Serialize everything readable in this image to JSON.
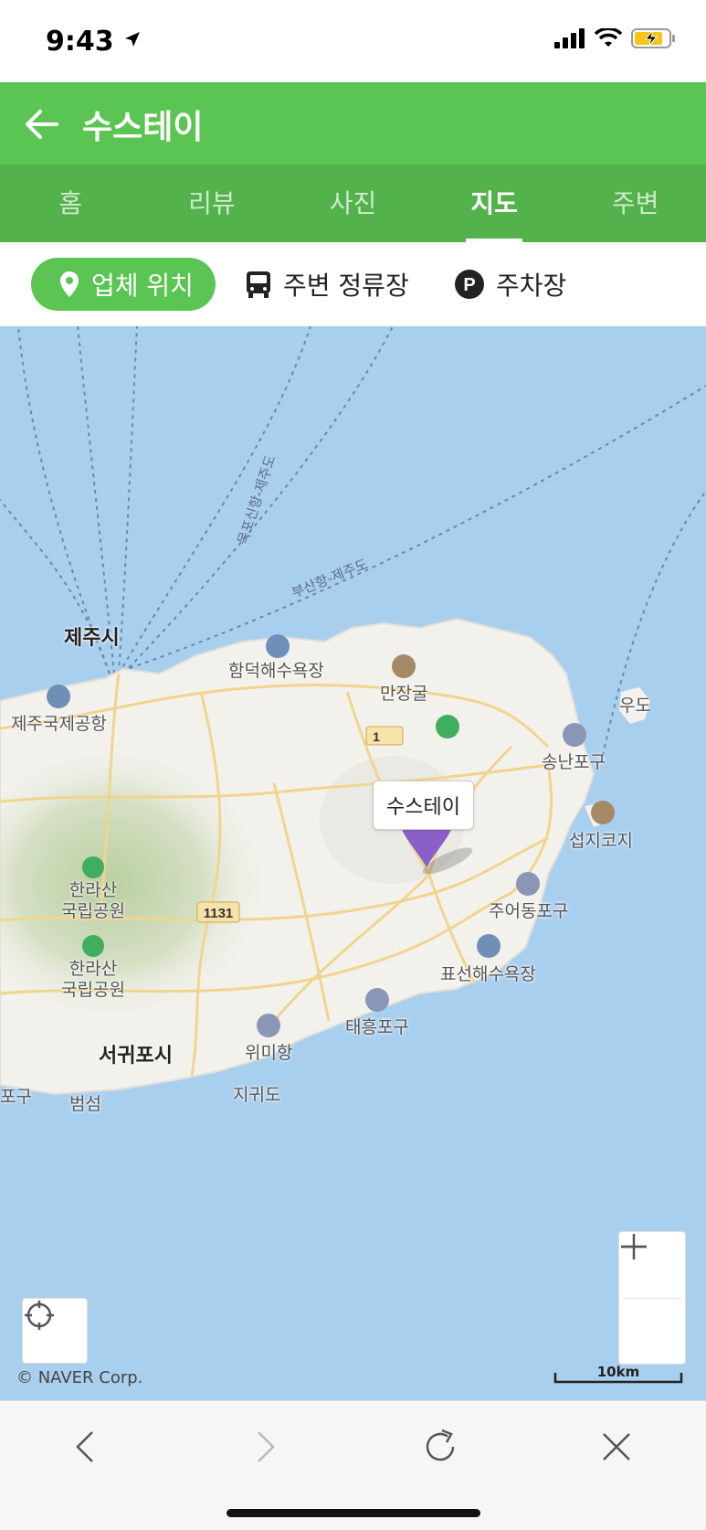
{
  "status": {
    "time": "9:43"
  },
  "header": {
    "title": "수스테이"
  },
  "tabs": [
    {
      "label": "홈"
    },
    {
      "label": "리뷰"
    },
    {
      "label": "사진"
    },
    {
      "label": "지도",
      "active": true
    },
    {
      "label": "주변"
    }
  ],
  "filters": {
    "location": "업체 위치",
    "bus": "주변 정류장",
    "parking": "주차장",
    "parking_glyph": "P"
  },
  "map": {
    "places": {
      "jeju_city": "제주시",
      "airport": "제주국제공항",
      "hamdeok": "함덕해수욕장",
      "manjanggul": "만장굴",
      "udo": "우도",
      "songnan": "송난포구",
      "seopjikoji": "섭지코지",
      "jueodong": "주어동포구",
      "pyoseon": "표선해수욕장",
      "taeheung": "태흥포구",
      "wimi": "위미항",
      "jigwido": "지귀도",
      "seogwipo": "서귀포시",
      "beomseom": "범섬",
      "hallasan1": "한라산\n국립공원",
      "hallasan2": "한라산\n국립공원",
      "pogu_partial": "포구"
    },
    "routes": {
      "mokpo": "목포신항-제주도",
      "busan": "부산항-제주도"
    },
    "road_number": "1131",
    "road_number_2": "1",
    "marker_label": "수스테이",
    "copyright": "© NAVER Corp.",
    "scale": "10km"
  },
  "colors": {
    "brand_green": "#5bc553",
    "tab_green": "#53b24b",
    "sea": "#a9cfee",
    "land": "#f2f1ec",
    "marker": "#8b5fc9"
  },
  "icons": {
    "back": "arrow-left-icon",
    "location": "map-pin-icon",
    "bus": "bus-icon",
    "parking": "parking-icon",
    "zoom_in": "plus-icon",
    "zoom_out": "minus-icon",
    "locate": "crosshair-icon",
    "nav_back": "chevron-left-icon",
    "nav_forward": "chevron-right-icon",
    "reload": "refresh-icon",
    "close": "close-icon"
  }
}
